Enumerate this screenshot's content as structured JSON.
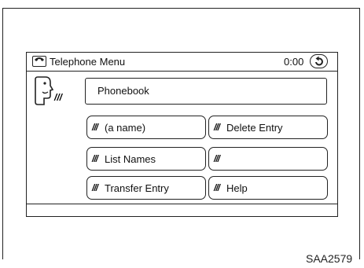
{
  "screen": {
    "title": "Telephone Menu",
    "clock": "0:00",
    "title_icon": "phone-icon",
    "back_icon": "back-icon"
  },
  "phonebook": {
    "label": "Phonebook",
    "voice_icon": "voice-command-head-icon"
  },
  "voice_mark": "′′′",
  "buttons": [
    {
      "label": "(a name)"
    },
    {
      "label": "Delete Entry"
    },
    {
      "label": "List Names"
    },
    {
      "label": ""
    },
    {
      "label": "Transfer Entry"
    },
    {
      "label": "Help"
    }
  ],
  "figure_code": "SAA2579"
}
